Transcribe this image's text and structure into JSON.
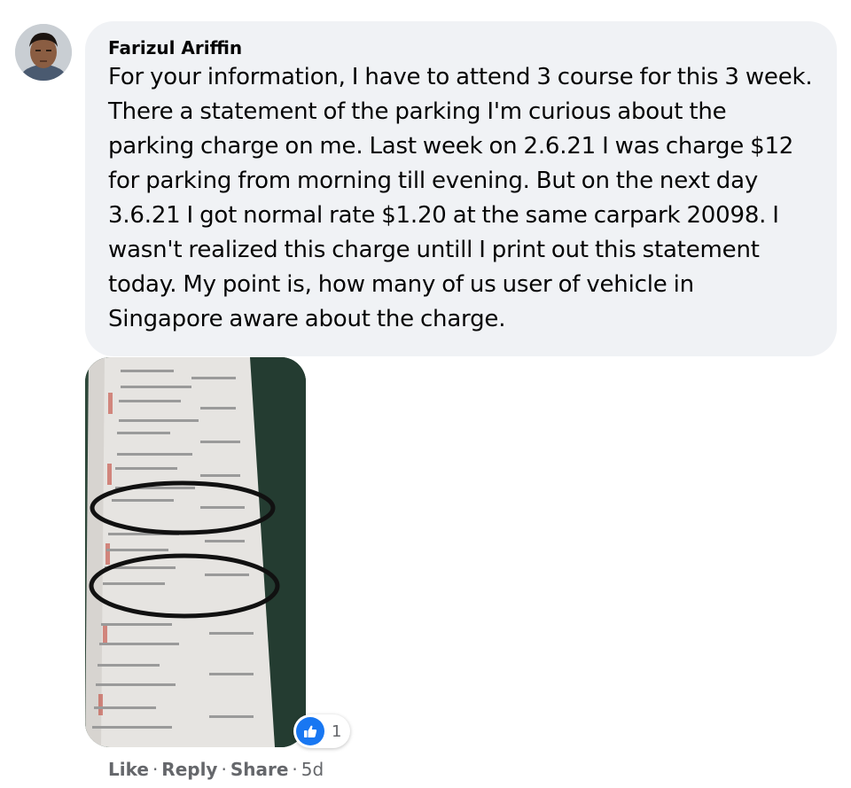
{
  "comment": {
    "author": "Farizul Ariffin",
    "text": "For your information, I have to attend 3 course for this 3 week. There a statement of the parking I'm curious about the parking charge on me. Last week on 2.6.21 I was charge $12 for parking from morning till evening. But on the next day 3.6.21 I got normal rate $1.20 at the same carpark 20098. I wasn't realized this charge untill I print out this statement today. My point is, how many of us user of vehicle in Singapore aware about the charge."
  },
  "reactions": {
    "icon": "like-icon",
    "count": "1",
    "color": "#1877f2"
  },
  "actions": {
    "like": "Like",
    "reply": "Reply",
    "share": "Share",
    "separator": "·",
    "timestamp": "5d"
  },
  "colors": {
    "bubble": "#f0f2f5",
    "text": "#050505",
    "secondary": "#65676b"
  }
}
